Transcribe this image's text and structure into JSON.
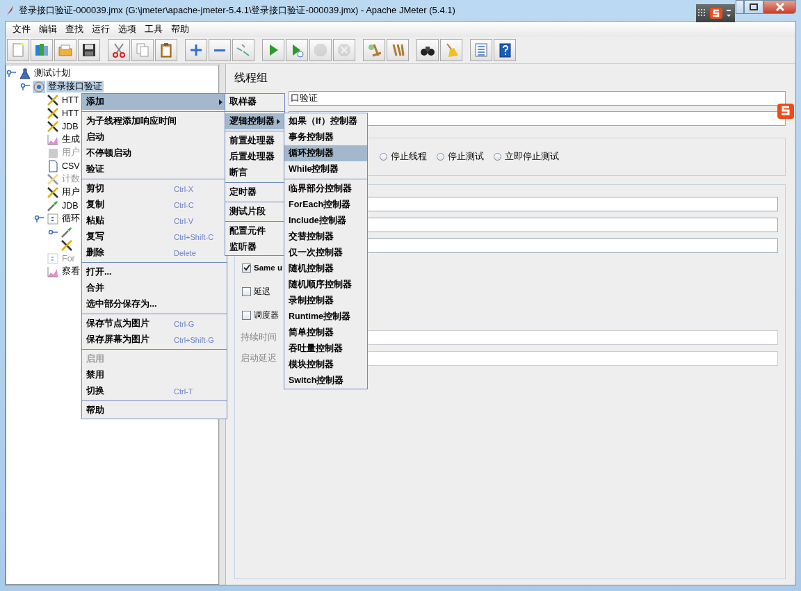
{
  "window": {
    "title": "登录接口验证-000039.jmx (G:\\jmeter\\apache-jmeter-5.4.1\\登录接口验证-000039.jmx) - Apache JMeter (5.4.1)"
  },
  "menu_bar": [
    "文件",
    "编辑",
    "查找",
    "运行",
    "选项",
    "工具",
    "帮助"
  ],
  "toolbar": [
    [
      {
        "disabled": false
      },
      {
        "disabled": false
      },
      {
        "disabled": false
      },
      {
        "disabled": false
      }
    ],
    [
      {
        "disabled": false
      },
      {
        "disabled": false
      },
      {
        "disabled": false
      }
    ],
    [
      {
        "disabled": false
      },
      {
        "disabled": false
      },
      {
        "disabled": false
      }
    ],
    [
      {
        "disabled": false
      },
      {
        "disabled": false
      },
      {
        "disabled": true
      },
      {
        "disabled": true
      }
    ],
    [
      {
        "disabled": false
      },
      {
        "disabled": false
      }
    ],
    [
      {
        "disabled": false
      },
      {
        "disabled": false
      }
    ],
    [
      {
        "disabled": false
      },
      {
        "disabled": false
      }
    ]
  ],
  "tree": [
    {
      "kind": "plan",
      "label": "测试计划",
      "selected": false,
      "disabled": false,
      "expanded": true,
      "children": [
        {
          "kind": "thread-group",
          "label": "登录接口验证",
          "selected": true,
          "disabled": false,
          "expanded": true,
          "children": [
            {
              "kind": "tool",
              "label": "HTT",
              "selected": false,
              "disabled": false
            },
            {
              "kind": "tool",
              "label": "HTT",
              "selected": false,
              "disabled": false
            },
            {
              "kind": "tool",
              "label": "JDB",
              "selected": false,
              "disabled": false
            },
            {
              "kind": "chart",
              "label": "生成",
              "selected": false,
              "disabled": false
            },
            {
              "kind": "block",
              "label": "用户",
              "selected": false,
              "disabled": true
            },
            {
              "kind": "document",
              "label": "CSV",
              "selected": false,
              "disabled": false
            },
            {
              "kind": "tool",
              "label": "计数",
              "selected": false,
              "disabled": true
            },
            {
              "kind": "tool",
              "label": "用户",
              "selected": false,
              "disabled": false
            },
            {
              "kind": "pipette",
              "label": "JDB",
              "selected": false,
              "disabled": false
            },
            {
              "kind": "controller",
              "label": "循环",
              "selected": false,
              "disabled": false,
              "expanded": true,
              "children": [
                {
                  "kind": "pipette",
                  "selected": false,
                  "disabled": false,
                  "expanded": false
                },
                {
                  "kind": "tool",
                  "selected": false,
                  "disabled": false
                }
              ]
            },
            {
              "kind": "controller",
              "label": "For",
              "selected": false,
              "disabled": true
            },
            {
              "kind": "chart",
              "label": "察看",
              "selected": false,
              "disabled": false
            }
          ]
        }
      ]
    }
  ],
  "panel": {
    "title": "线程组",
    "fields": [
      {
        "kind": "text",
        "value": "口验证"
      },
      {
        "kind": "blank"
      }
    ],
    "on_error_actions": [
      {
        "label": "停止线程",
        "selected": false
      },
      {
        "label": "停止测试",
        "selected": false
      },
      {
        "label": "立即停止测试",
        "selected": false
      }
    ],
    "thread_properties": [
      {
        "kind": "field"
      },
      {
        "kind": "field"
      },
      {
        "kind": "field"
      },
      {
        "kind": "checkbox",
        "label": "Same u",
        "checked": true
      },
      {
        "kind": "checkbox",
        "label": "延迟",
        "checked": false
      },
      {
        "kind": "checkbox",
        "label": "调度器",
        "checked": false
      },
      {
        "kind": "field",
        "label": "持续时间",
        "disabled": true
      },
      {
        "kind": "field",
        "label": "启动延迟",
        "disabled": true
      }
    ]
  },
  "context_menu": [
    [
      {
        "label": "添加",
        "selected": true,
        "submenu": [
          [
            {
              "label": "取样器",
              "selected": false
            }
          ],
          [
            {
              "label": "逻辑控制器",
              "selected": true,
              "submenu": [
                [
                  {
                    "label": "如果（If）控制器",
                    "selected": false
                  },
                  {
                    "label": "事务控制器",
                    "selected": false
                  },
                  {
                    "label": "循环控制器",
                    "selected": true
                  },
                  {
                    "label": "While控制器",
                    "selected": false
                  }
                ],
                [
                  {
                    "label": "临界部分控制器",
                    "selected": false
                  },
                  {
                    "label": "ForEach控制器",
                    "selected": false
                  },
                  {
                    "label": "Include控制器",
                    "selected": false
                  },
                  {
                    "label": "交替控制器",
                    "selected": false
                  },
                  {
                    "label": "仅一次控制器",
                    "selected": false
                  },
                  {
                    "label": "随机控制器",
                    "selected": false
                  },
                  {
                    "label": "随机顺序控制器",
                    "selected": false
                  },
                  {
                    "label": "录制控制器",
                    "selected": false
                  },
                  {
                    "label": "Runtime控制器",
                    "selected": false
                  },
                  {
                    "label": "简单控制器",
                    "selected": false
                  },
                  {
                    "label": "吞吐量控制器",
                    "selected": false
                  },
                  {
                    "label": "模块控制器",
                    "selected": false
                  },
                  {
                    "label": "Switch控制器",
                    "selected": false
                  }
                ]
              ]
            }
          ],
          [
            {
              "label": "前置处理器",
              "selected": false
            },
            {
              "label": "后置处理器",
              "selected": false
            },
            {
              "label": "断言",
              "selected": false
            }
          ],
          [
            {
              "label": "定时器",
              "selected": false
            }
          ],
          [
            {
              "label": "测试片段",
              "selected": false
            }
          ],
          [
            {
              "label": "配置元件",
              "selected": false
            },
            {
              "label": "监听器",
              "selected": false
            }
          ]
        ]
      }
    ],
    [
      {
        "label": "为子线程添加响应时间",
        "selected": false
      },
      {
        "label": "启动",
        "selected": false
      },
      {
        "label": "不停顿启动",
        "selected": false
      },
      {
        "label": "验证",
        "selected": false
      }
    ],
    [
      {
        "label": "剪切",
        "shortcut": "Ctrl-X",
        "selected": false
      },
      {
        "label": "复制",
        "shortcut": "Ctrl-C",
        "selected": false
      },
      {
        "label": "粘贴",
        "shortcut": "Ctrl-V",
        "selected": false
      },
      {
        "label": "复写",
        "shortcut": "Ctrl+Shift-C",
        "selected": false
      },
      {
        "label": "删除",
        "shortcut": "Delete",
        "selected": false
      }
    ],
    [
      {
        "label": "打开...",
        "selected": false
      },
      {
        "label": "合并",
        "selected": false
      },
      {
        "label": "选中部分保存为...",
        "selected": false
      }
    ],
    [
      {
        "label": "保存节点为图片",
        "shortcut": "Ctrl-G",
        "selected": false
      },
      {
        "label": "保存屏幕为图片",
        "shortcut": "Ctrl+Shift-G",
        "selected": false
      }
    ],
    [
      {
        "label": "启用",
        "selected": false,
        "disabled": true
      },
      {
        "label": "禁用",
        "selected": false
      },
      {
        "label": "切换",
        "shortcut": "Ctrl-T",
        "selected": false
      }
    ],
    [
      {
        "label": "帮助",
        "selected": false
      }
    ]
  ]
}
